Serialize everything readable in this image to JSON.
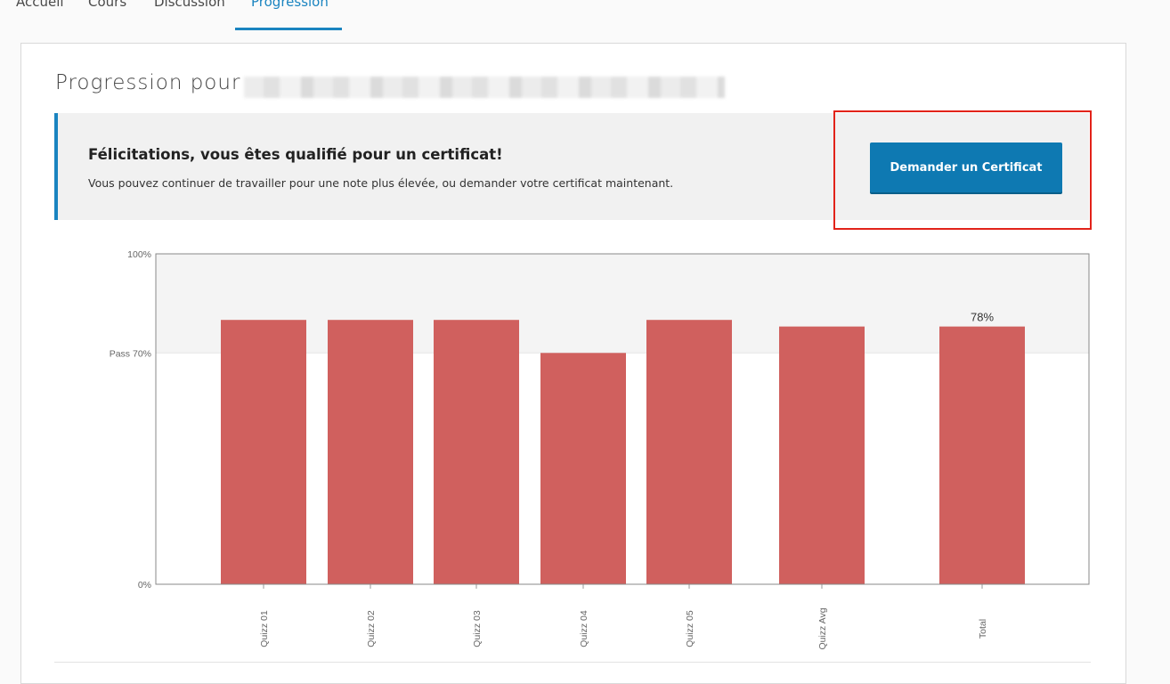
{
  "tabs": [
    {
      "label": "Accueil"
    },
    {
      "label": "Cours"
    },
    {
      "label": "Discussion"
    },
    {
      "label": "Progression"
    }
  ],
  "page": {
    "title": "Progression pour"
  },
  "banner": {
    "title": "Félicitations, vous êtes qualifié pour un certificat!",
    "text": "Vous pouvez continuer de travailler pour une note plus élevée, ou demander votre certificat maintenant.",
    "button_label": "Demander un Certificat"
  },
  "colors": {
    "accent": "#1a84c0",
    "bar": "#d0605e",
    "highlight": "#e2231a"
  },
  "chart_data": {
    "type": "bar",
    "categories": [
      "Quizz 01",
      "Quizz 02",
      "Quizz 03",
      "Quizz 04",
      "Quizz 05",
      "Quizz Avg",
      "Total"
    ],
    "values": [
      80,
      80,
      80,
      70,
      80,
      78,
      78
    ],
    "ylim": [
      0,
      100
    ],
    "y_ticks": [
      {
        "value": 100,
        "label": "100%"
      },
      {
        "value": 70,
        "label": "Pass 70%"
      },
      {
        "value": 0,
        "label": "0%"
      }
    ],
    "pass_threshold": 70,
    "annotations": [
      {
        "category": "Total",
        "label": "78%"
      }
    ]
  }
}
